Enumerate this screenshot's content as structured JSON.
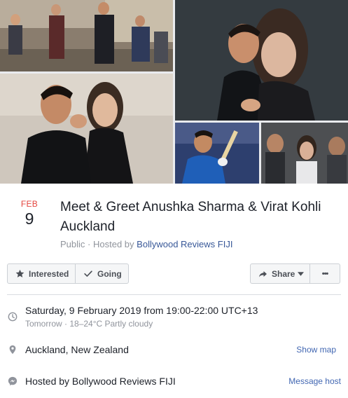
{
  "event": {
    "month": "FEB",
    "day": "9",
    "title": "Meet & Greet Anushka Sharma & Virat Kohli Auckland",
    "privacy": "Public",
    "hosted_prefix": "Hosted by",
    "host_name": "Bollywood Reviews FIJI"
  },
  "actions": {
    "interested_label": "Interested",
    "going_label": "Going",
    "share_label": "Share",
    "more_label": "•••"
  },
  "details": {
    "datetime": "Saturday, 9 February 2019 from 19:00-22:00 UTC+13",
    "weather": "Tomorrow · 18–24°C Partly cloudy",
    "location": "Auckland, New Zealand",
    "show_map_label": "Show map",
    "hosted_by_text": "Hosted by Bollywood Reviews FIJI",
    "message_host_label": "Message host"
  },
  "icons": {
    "clock": "clock-icon",
    "location": "location-pin-icon",
    "messenger": "messenger-icon",
    "star": "star-icon",
    "check": "check-icon",
    "share": "share-arrow-icon"
  },
  "colors": {
    "month_red": "#e4463f",
    "link_blue": "#385898",
    "action_blue": "#4267b2"
  }
}
